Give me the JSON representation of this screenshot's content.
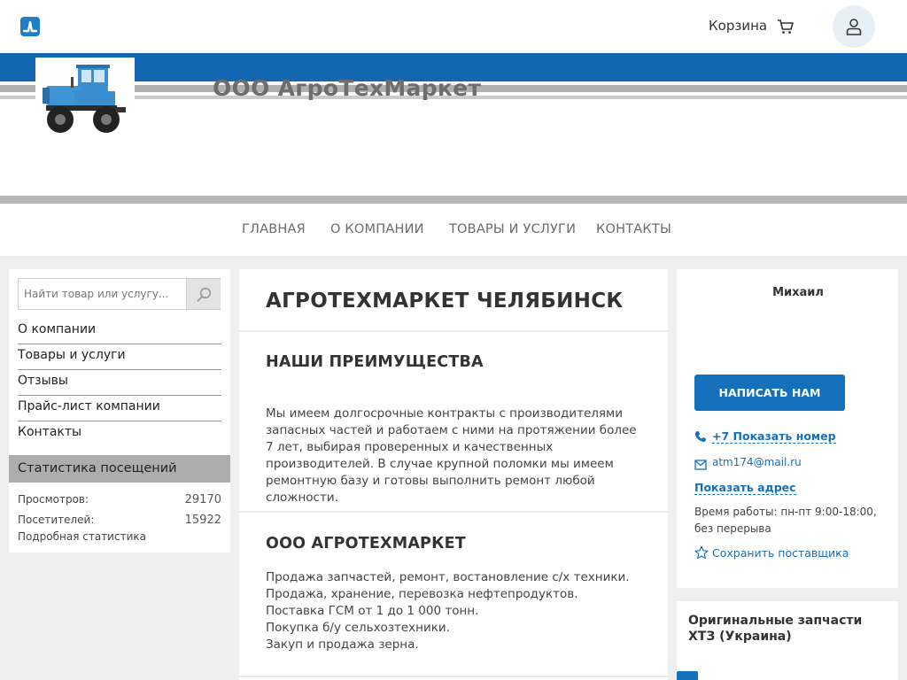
{
  "header": {
    "cart_label": "Корзина"
  },
  "banner": {
    "company_title": "ООО АгроТехМаркет"
  },
  "nav": {
    "items": [
      "ГЛАВНАЯ",
      "О КОМПАНИИ",
      "ТОВАРЫ И УСЛУГИ",
      "КОНТАКТЫ"
    ]
  },
  "sidebar": {
    "search_placeholder": "Найти товар или услугу...",
    "menu": [
      "О компании",
      "Товары и услуги",
      "Отзывы",
      "Прайс-лист компании",
      "Контакты"
    ],
    "stats": {
      "heading": "Статистика посещений",
      "views_label": "Просмотров:",
      "views_value": "29170",
      "visitors_label": "Посетителей:",
      "visitors_value": "15922",
      "detail_link": "Подробная статистика"
    }
  },
  "main": {
    "title": "АГРОТЕХМАРКЕТ ЧЕЛЯБИНСК",
    "advantages_title": "НАШИ ПРЕИМУЩЕСТВА",
    "advantages_text": "Мы имеем долгосрочные контракты с производителями запасных частей и работаем с ними на протяжении более 7 лет, выбирая проверенных и качественных производителей. В случае крупной поломки мы имеем ремонтную базу и готовы выполнить ремонт любой сложности.",
    "company_title": "ООО АГРОТЕХМАРКЕТ",
    "services": [
      "Продажа запчастей, ремонт, востановление с/х техники.",
      "Продажа, хранение, перевозка нефтепродуктов.",
      "Поставка ГСМ от 1 до 1 000 тонн.",
      "Покупка б/у сельхозтехники.",
      "Закуп и продажа зерна."
    ]
  },
  "contact": {
    "name": "Михаил",
    "write_button": "НАПИСАТЬ НАМ",
    "phone_link": "+7 Показать номер",
    "email": "atm174@mail.ru",
    "address_link": "Показать адрес",
    "hours": "Время работы: пн-пт 9:00-18:00, без перерыва",
    "save_supplier": "Сохранить поставщика"
  },
  "promo": {
    "title": "Оригинальные запчасти ХТЗ (Украина)"
  },
  "colors": {
    "accent_blue": "#1570bc",
    "banner_blue": "#1366b0",
    "banner_grey": "#aeb0b2",
    "stats_header_grey": "#adadad"
  },
  "icons": [
    "site-logo-icon",
    "cart-icon",
    "user-icon",
    "search-icon",
    "phone-icon",
    "mail-icon",
    "star-icon",
    "tractor-image"
  ]
}
